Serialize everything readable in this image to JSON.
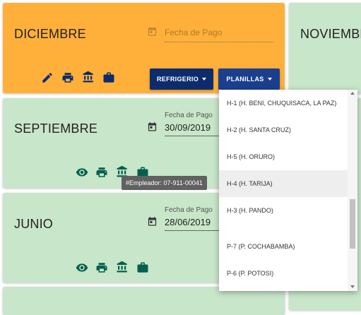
{
  "cards": {
    "diciembre": {
      "month": "DICIEMBRE",
      "date_placeholder": "Fecha de Pago"
    },
    "noviembre": {
      "month": "NOVIEMBRE"
    },
    "septiembre": {
      "month": "SEPTIEMBRE",
      "date_label": "Fecha de Pago",
      "date_value": "30/09/2019"
    },
    "junio": {
      "month": "JUNIO",
      "date_label": "Fecha de Pago",
      "date_value": "28/06/2019"
    }
  },
  "buttons": {
    "refrigerio": "REFRIGERIO",
    "planillas": "PLANILLAS"
  },
  "tooltip": "#Empleador: 07-911-00041",
  "dropdown_items": [
    "H-1 (H. BENI, CHUQUISACA, LA PAZ)",
    "H-2 (H. SANTA CRUZ)",
    "H-5 (H. ORURO)",
    "H-4 (H. TARIJA)",
    "H-3 (H. PANDO)",
    "P-7 (P. COCHABAMBA)",
    "P-6 (P. POTOSI)"
  ],
  "colors": {
    "orange": "#FFB03B",
    "green": "#C8E6C9",
    "navy": "#1B3F8F",
    "icon_dark": "#0D2C6E",
    "icon_green": "#00604D"
  },
  "icons": [
    "calendar-icon",
    "edit-icon",
    "print-icon",
    "bank-icon",
    "briefcase-icon",
    "eye-icon"
  ]
}
